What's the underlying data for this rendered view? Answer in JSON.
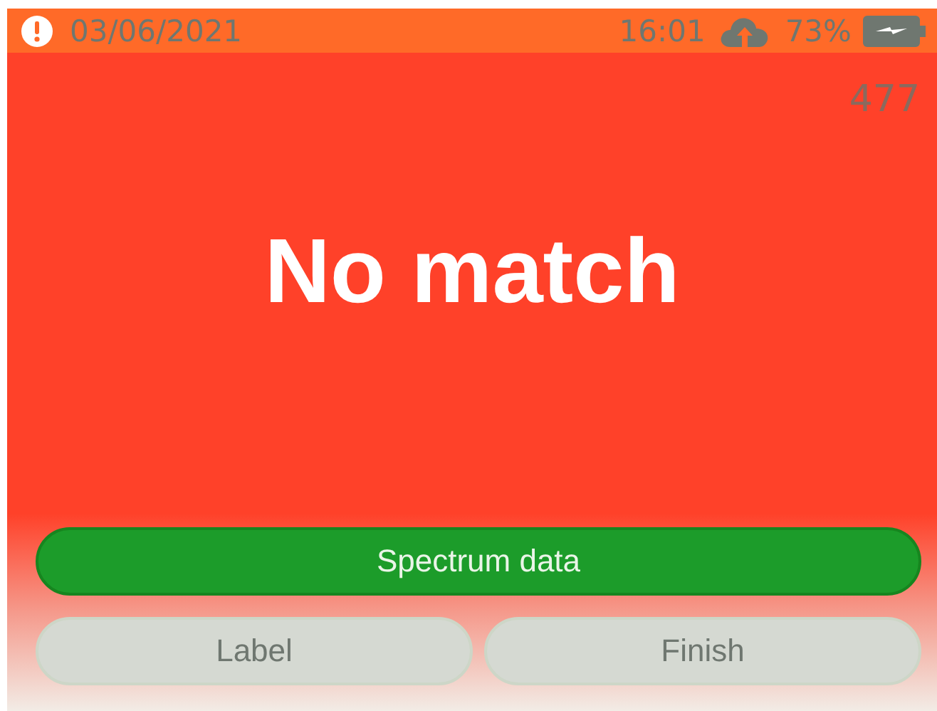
{
  "status_bar": {
    "date": "03/06/2021",
    "time": "16:01",
    "battery": "73%"
  },
  "counter": "477",
  "result": "No match",
  "buttons": [
    {
      "label": "Spectrum data",
      "kind": "primary"
    },
    {
      "label": "Label",
      "kind": "secondary"
    },
    {
      "label": "Finish",
      "kind": "secondary"
    }
  ]
}
